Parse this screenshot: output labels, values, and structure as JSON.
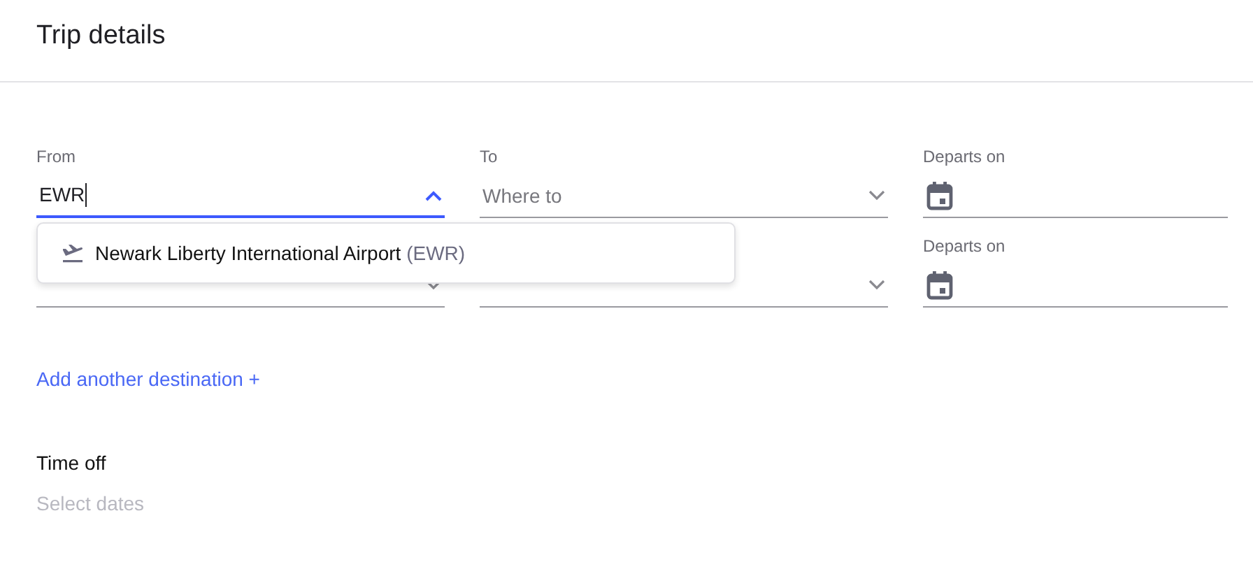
{
  "title": "Trip details",
  "legs": [
    {
      "fields": [
        {
          "kind": "airport",
          "label": "From",
          "value": "EWR",
          "focused": true,
          "expanded": true
        },
        {
          "kind": "airport",
          "label": "To",
          "placeholder": "Where to",
          "focused": false,
          "expanded": false
        },
        {
          "kind": "date",
          "label": "Departs on"
        }
      ]
    },
    {
      "fields": [
        {
          "kind": "airport",
          "focused": false
        },
        {
          "kind": "airport",
          "focused": false
        },
        {
          "kind": "date",
          "label": "Departs on"
        }
      ]
    }
  ],
  "suggestions": [
    {
      "name": "Newark Liberty International Airport",
      "code": "(EWR)"
    }
  ],
  "add_link": "Add another destination +",
  "time_off": {
    "label": "Time off",
    "placeholder": "Select dates"
  }
}
